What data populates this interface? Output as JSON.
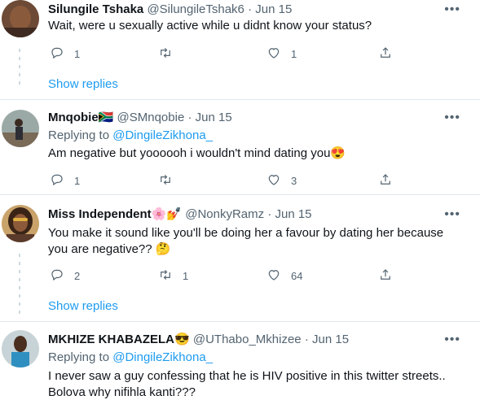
{
  "tweets": [
    {
      "name": "Silungile Tshaka",
      "handle": "@SilungileTshak6",
      "sep": "·",
      "date": "Jun 15",
      "text": "Wait, were u sexually active while u didnt know your status?",
      "replies": "1",
      "retweets": "",
      "likes": "1",
      "show_replies": "Show replies"
    },
    {
      "name": "Mnqobie",
      "name_emoji": "🇿🇦",
      "handle": "@SMnqobie",
      "sep": "·",
      "date": "Jun 15",
      "replying_prefix": "Replying to",
      "replying_to": "@DingileZikhona_",
      "text": "Am negative but yoooooh i wouldn't mind dating you",
      "text_emoji": "😍",
      "replies": "1",
      "retweets": "",
      "likes": "3"
    },
    {
      "name": "Miss Independent",
      "name_emoji": "🌸💅",
      "handle": "@NonkyRamz",
      "sep": "·",
      "date": "Jun 15",
      "text": "You make it sound like you'll be doing her a favour by dating her because you are negative??",
      "text_emoji": "🤔",
      "replies": "2",
      "retweets": "1",
      "likes": "64",
      "show_replies": "Show replies"
    },
    {
      "name": "MKHIZE KHABAZELA",
      "name_emoji": "😎",
      "handle": "@UThabo_Mkhizee",
      "sep": "·",
      "date": "Jun 15",
      "replying_prefix": "Replying to",
      "replying_to": "@DingileZikhona_",
      "text": "I never saw a guy confessing that he is HIV positive in this twitter streets.. Bolova why nifihla kanti???"
    }
  ],
  "icons": {
    "reply": "reply-icon",
    "retweet": "retweet-icon",
    "like": "like-icon",
    "share": "share-icon",
    "more": "more-icon"
  },
  "colors": {
    "accent": "#1d9bf0",
    "secondary_text": "#536471",
    "divider": "#e1e8ed"
  }
}
